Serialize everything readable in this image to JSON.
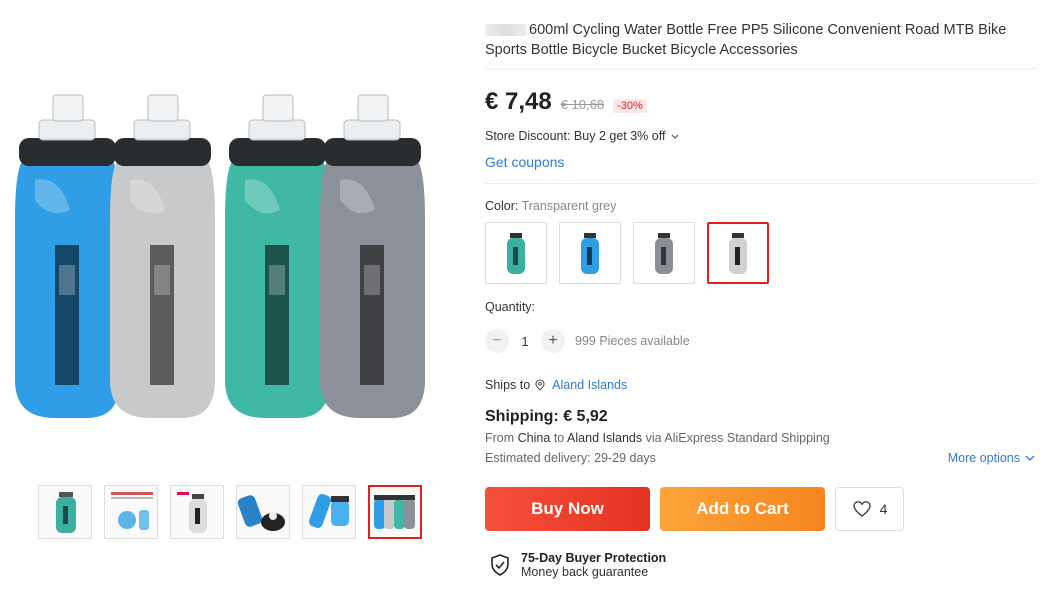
{
  "product": {
    "title": "600ml Cycling Water Bottle Free PP5 Silicone Convenient Road MTB Bike Sports Bottle Bicycle Bucket Bicycle Accessories"
  },
  "price": {
    "current": "€ 7,48",
    "original": "€ 10,68",
    "discount": "-30%"
  },
  "store_discount": "Store Discount: Buy 2 get 3% off",
  "coupons_link": "Get coupons",
  "color": {
    "label": "Color:",
    "selected": "Transparent grey",
    "options": [
      {
        "bottle": "#3bb0a0"
      },
      {
        "bottle": "#2f9ee6"
      },
      {
        "bottle": "#8a8e96"
      },
      {
        "bottle": "#cfd0d2"
      }
    ]
  },
  "quantity": {
    "label": "Quantity:",
    "value": "1",
    "minus": "−",
    "plus": "+",
    "available": "999 Pieces available"
  },
  "shipping": {
    "ships_to_label": "Ships to",
    "destination": "Aland Islands",
    "price": "Shipping: € 5,92",
    "from_prefix": "From",
    "origin": "China",
    "to_word": "to",
    "to_destination": "Aland Islands",
    "via": "via AliExpress Standard Shipping",
    "delivery": "Estimated delivery: 29-29 days",
    "more_options": "More options"
  },
  "actions": {
    "buy_now": "Buy Now",
    "add_to_cart": "Add to Cart",
    "wishlist_count": "4"
  },
  "protection": {
    "title": "75-Day Buyer Protection",
    "subtitle": "Money back guarantee"
  },
  "gallery": {
    "main_bottles": [
      "#2f9ee6",
      "#c8c9cb",
      "#3fb8a6",
      "#8c9099"
    ],
    "thumbnail_count": 6,
    "active_thumbnail": 6
  },
  "colors": {
    "accent_red": "#e02020",
    "link_blue": "#2f7ccf",
    "buy_orange_red": "#f5513a",
    "cart_orange": "#fca438"
  }
}
